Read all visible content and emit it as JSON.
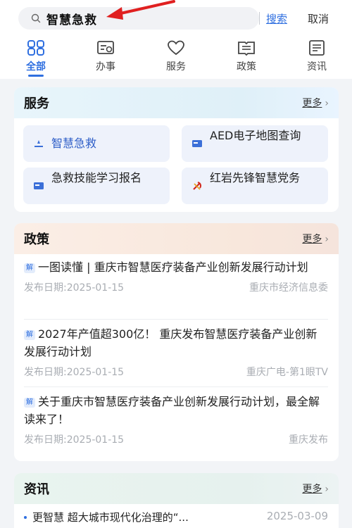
{
  "search": {
    "query": "智慧急救",
    "submit_label": "搜索",
    "cancel_label": "取消"
  },
  "tabs": [
    {
      "label": "全部",
      "icon": "grid-icon",
      "active": true
    },
    {
      "label": "办事",
      "icon": "task-icon",
      "active": false
    },
    {
      "label": "服务",
      "icon": "heart-icon",
      "active": false
    },
    {
      "label": "政策",
      "icon": "policy-book-icon",
      "active": false
    },
    {
      "label": "资讯",
      "icon": "news-icon",
      "active": false
    }
  ],
  "services": {
    "title": "服务",
    "more_label": "更多",
    "items": [
      {
        "label": "智慧急救",
        "icon": "ambulance-icon"
      },
      {
        "label": "AED电子地图查询",
        "icon": "card-icon"
      },
      {
        "label": "急救技能学习报名",
        "icon": "card-icon"
      },
      {
        "label": "红岩先锋智慧党务",
        "icon": "party-emblem-icon"
      }
    ]
  },
  "policy": {
    "title": "政策",
    "more_label": "更多",
    "badge": "解",
    "items": [
      {
        "title": "一图读懂 | 重庆市智慧医疗装备产业创新发展行动计划",
        "date": "发布日期:2025-01-15",
        "source": "重庆市经济信息委"
      },
      {
        "title": "2027年产值超300亿！ 重庆发布智慧医疗装备产业创新发展行动计划",
        "date": "发布日期:2025-01-15",
        "source": "重庆广电-第1眼TV"
      },
      {
        "title": "关于重庆市智慧医疗装备产业创新发展行动计划，最全解读来了！",
        "date": "发布日期:2025-01-15",
        "source": "重庆发布"
      }
    ]
  },
  "info": {
    "title": "资讯",
    "more_label": "更多",
    "items": [
      {
        "title": "更智慧 超大城市现代化治理的“...",
        "date": "2025-03-09"
      }
    ]
  },
  "colors": {
    "accent": "#2f6fe0",
    "annotation_arrow": "#e02020"
  }
}
